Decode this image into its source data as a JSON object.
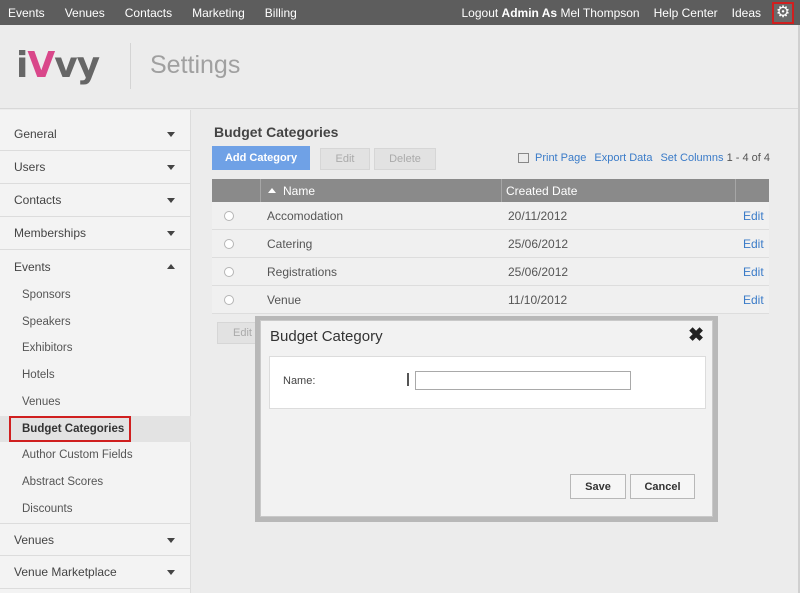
{
  "topnav": {
    "left": [
      "Events",
      "Venues",
      "Contacts",
      "Marketing",
      "Billing"
    ],
    "logout_prefix": "Logout",
    "logout_user": "Admin As",
    "logout_name": "Mel Thompson",
    "help": "Help Center",
    "ideas": "Ideas",
    "settings_icon": "gear-icon"
  },
  "header": {
    "logo_i": "i",
    "logo_v": "V",
    "logo_rest": "vy",
    "title": "Settings"
  },
  "sidebar": {
    "general": "General",
    "users": "Users",
    "contacts": "Contacts",
    "memberships": "Memberships",
    "events": "Events",
    "sub": [
      "Sponsors",
      "Speakers",
      "Exhibitors",
      "Hotels",
      "Venues",
      "Budget Categories",
      "Author Custom Fields",
      "Abstract Scores",
      "Discounts"
    ],
    "venues": "Venues",
    "venue_marketplace": "Venue Marketplace"
  },
  "main": {
    "title": "Budget Categories",
    "add_button": "Add Category",
    "edit_button": "Edit",
    "delete_button": "Delete",
    "print": "Print Page",
    "export": "Export Data",
    "set_columns": "Set Columns",
    "pager": "1 - 4 of 4",
    "columns": [
      "Name",
      "Created Date"
    ],
    "rows": [
      {
        "name": "Accomodation",
        "date": "20/11/2012",
        "action": "Edit"
      },
      {
        "name": "Catering",
        "date": "25/06/2012",
        "action": "Edit"
      },
      {
        "name": "Registrations",
        "date": "25/06/2012",
        "action": "Edit"
      },
      {
        "name": "Venue",
        "date": "11/10/2012",
        "action": "Edit"
      }
    ],
    "bottom_edit": "Edit"
  },
  "modal": {
    "title": "Budget Category",
    "close": "✖",
    "name_label": "Name:",
    "name_value": "",
    "save": "Save",
    "cancel": "Cancel"
  }
}
